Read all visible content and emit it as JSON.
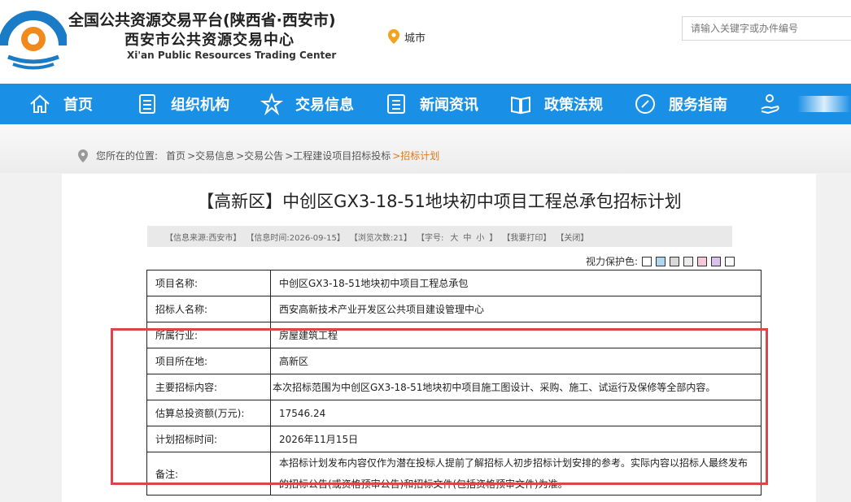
{
  "header": {
    "title_line1": "全国公共资源交易平台(陕西省·西安市)",
    "title_line2": "西安市公共资源交易中心",
    "title_line3": "Xi'an Public Resources Trading Center",
    "city_label": "城市",
    "search_placeholder": "请输入关键字或办件编号"
  },
  "nav": {
    "items": [
      {
        "label": "首页",
        "icon": "home-icon"
      },
      {
        "label": "组织机构",
        "icon": "document-icon"
      },
      {
        "label": "交易信息",
        "icon": "star-icon"
      },
      {
        "label": "新闻资讯",
        "icon": "news-icon"
      },
      {
        "label": "政策法规",
        "icon": "book-icon"
      },
      {
        "label": "服务指南",
        "icon": "compass-icon"
      }
    ]
  },
  "breadcrumb": {
    "label": "您所在的位置:",
    "items": [
      "首页",
      ">交易信息",
      ">交易公告",
      ">工程建设项目招标投标",
      ">招标计划"
    ]
  },
  "article": {
    "title": "【高新区】中创区GX3-18-51地块初中项目工程总承包招标计划",
    "meta": {
      "source": "【信息来源:西安市】",
      "time": "【信息时间:2026-09-15】",
      "views": "【浏览次数:21】",
      "font_label": "【字号:",
      "font_sizes": [
        "大",
        "中",
        "小"
      ],
      "font_end": "】",
      "print": "【我要打印】",
      "close": "【关闭】"
    },
    "eye_label": "视力保护色:",
    "eye_colors": [
      "#ffffff",
      "#aed8f0",
      "#d8d8d8",
      "#ececec",
      "#f8c8d8",
      "#d8c0f0",
      "#ffffff"
    ],
    "rows": [
      {
        "key": "项目名称:",
        "value": "中创区GX3-18-51地块初中项目工程总承包"
      },
      {
        "key": "招标人名称:",
        "value": "西安高新技术产业开发区公共项目建设管理中心"
      },
      {
        "key": "所属行业:",
        "value": "房屋建筑工程"
      },
      {
        "key": "项目所在地:",
        "value": "高新区"
      },
      {
        "key": "主要招标内容:",
        "value": "本次招标范围为中创区GX3-18-51地块初中项目施工图设计、采购、施工、试运行及保修等全部内容。"
      },
      {
        "key": "估算总投资额(万元):",
        "value": "17546.24"
      },
      {
        "key": "计划招标时间:",
        "value": "2026年11月15日"
      },
      {
        "key": "备注:",
        "value": "本招标计划发布内容仅作为潜在投标人提前了解招标人初步招标计划安排的参考。实际内容以招标人最终发布的招标公告(或资格预审公告)和招标文件(包括资格预审文件)为准。"
      }
    ]
  },
  "colors": {
    "nav_bg": "#1a8fe6",
    "accent_orange": "#e2791c",
    "highlight_red": "#d9464b"
  }
}
